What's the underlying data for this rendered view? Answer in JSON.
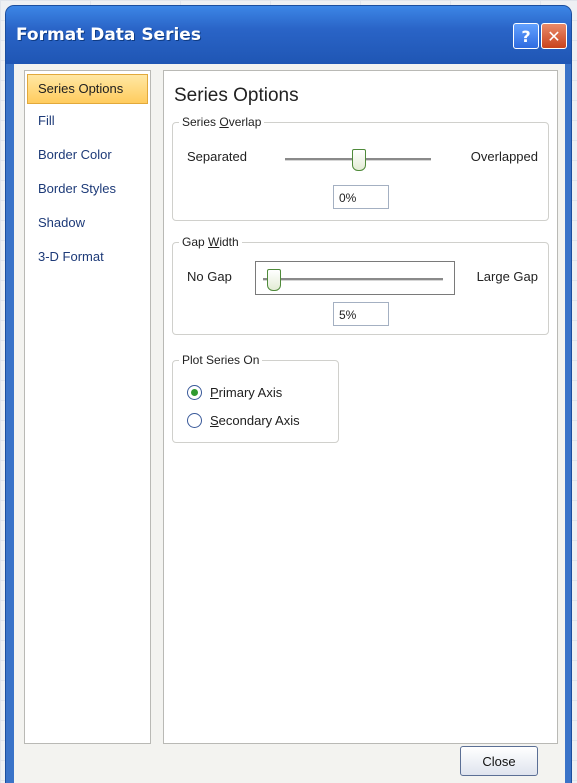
{
  "dialog": {
    "title": "Format Data Series",
    "help_glyph": "?",
    "close_glyph": "✕"
  },
  "nav": {
    "items": [
      {
        "label": "Series Options",
        "active": true
      },
      {
        "label": "Fill"
      },
      {
        "label": "Border Color"
      },
      {
        "label": "Border Styles"
      },
      {
        "label": "Shadow"
      },
      {
        "label": "3-D Format"
      }
    ]
  },
  "panel": {
    "title": "Series Options",
    "overlap": {
      "legend_prefix": "Series ",
      "legend_accel": "O",
      "legend_suffix": "verlap",
      "left_label": "Separated",
      "right_label": "Overlapped",
      "value": "0%",
      "slider_fraction": 0.5
    },
    "gap": {
      "legend_prefix": "Gap ",
      "legend_accel": "W",
      "legend_suffix": "idth",
      "left_label": "No Gap",
      "right_label": "Large Gap",
      "value": "5%",
      "slider_fraction": 0.01
    },
    "plot_on": {
      "legend": "Plot Series On",
      "options": [
        {
          "accel": "P",
          "rest": "rimary Axis",
          "selected": true
        },
        {
          "accel": "S",
          "rest": "econdary Axis",
          "selected": false
        }
      ]
    }
  },
  "footer": {
    "close_label": "Close"
  }
}
